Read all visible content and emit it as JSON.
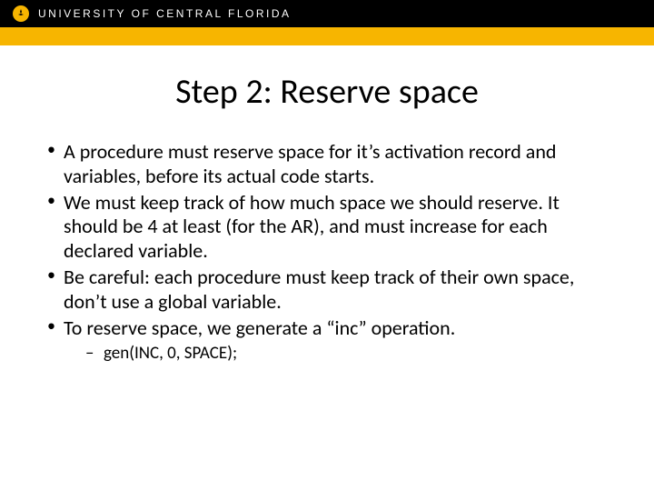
{
  "header": {
    "university_name": "UNIVERSITY OF CENTRAL FLORIDA"
  },
  "slide": {
    "title": "Step 2: Reserve space",
    "bullets": [
      "A procedure must reserve space for it’s activation record and variables, before its actual code starts.",
      "We must keep track of how much space we should reserve. It should be 4 at least (for the AR), and must increase for each declared variable.",
      "Be careful: each procedure must keep track of their own space, don’t use a global variable.",
      "To reserve space, we generate a “inc” operation."
    ],
    "sub_bullet": "gen(INC, 0, SPACE);"
  }
}
